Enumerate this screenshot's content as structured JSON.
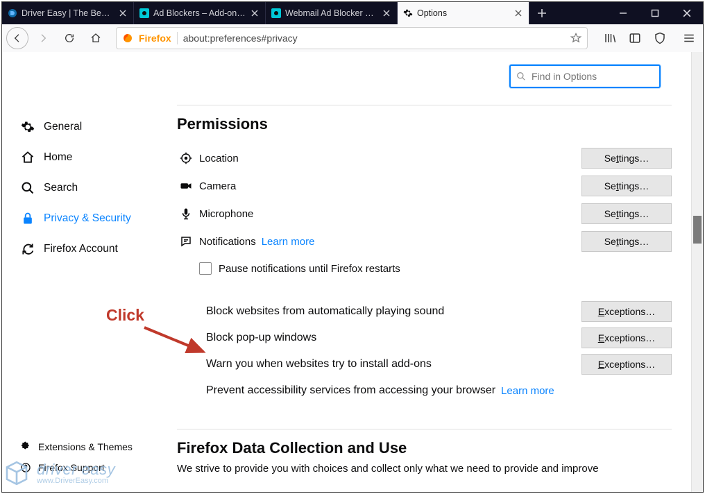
{
  "tabs": [
    {
      "label": "Driver Easy | The Best Fr…"
    },
    {
      "label": "Ad Blockers – Add-ons fo…"
    },
    {
      "label": "Webmail Ad Blocker – Ge…"
    },
    {
      "label": "Options"
    }
  ],
  "urlbar": {
    "identity": "Firefox",
    "address": "about:preferences#privacy"
  },
  "search": {
    "placeholder": "Find in Options"
  },
  "sidebar": {
    "items": [
      {
        "label": "General"
      },
      {
        "label": "Home"
      },
      {
        "label": "Search"
      },
      {
        "label": "Privacy & Security"
      },
      {
        "label": "Firefox Account"
      }
    ],
    "bottom": [
      {
        "label": "Extensions & Themes"
      },
      {
        "label": "Firefox Support"
      }
    ]
  },
  "permissions": {
    "heading": "Permissions",
    "rows": [
      {
        "label": "Location",
        "button": "Settings…"
      },
      {
        "label": "Camera",
        "button": "Settings…"
      },
      {
        "label": "Microphone",
        "button": "Settings…"
      },
      {
        "label": "Notifications",
        "button": "Settings…",
        "learn": "Learn more"
      }
    ],
    "pause": "Pause notifications until Firefox restarts",
    "options": [
      {
        "text": "Block websites from automatically playing sound",
        "ul": "B",
        "rest": "lock websites from automatically playing sound",
        "button": "Exceptions…",
        "checked": true
      },
      {
        "text": "Block pop-up windows",
        "ul": "B",
        "rest": "lock pop-up windows",
        "button": "Exceptions…",
        "checked": true,
        "highlight": true
      },
      {
        "text": "Warn you when websites try to install add-ons",
        "ul": "W",
        "rest": "arn you when websites try to install add-ons",
        "button": "Exceptions…",
        "checked": true
      },
      {
        "text": "Prevent accessibility services from accessing your browser",
        "ul": "a",
        "pre": "Prevent ",
        "rest": "ccessibility services from accessing your browser",
        "learn": "Learn more",
        "checked": false
      }
    ]
  },
  "datacollection": {
    "heading": "Firefox Data Collection and Use",
    "blurb": "We strive to provide you with choices and collect only what we need to provide and improve"
  },
  "annotation": {
    "label": "Click"
  },
  "watermark": {
    "brand": "driver easy",
    "url": "www.DriverEasy.com"
  }
}
